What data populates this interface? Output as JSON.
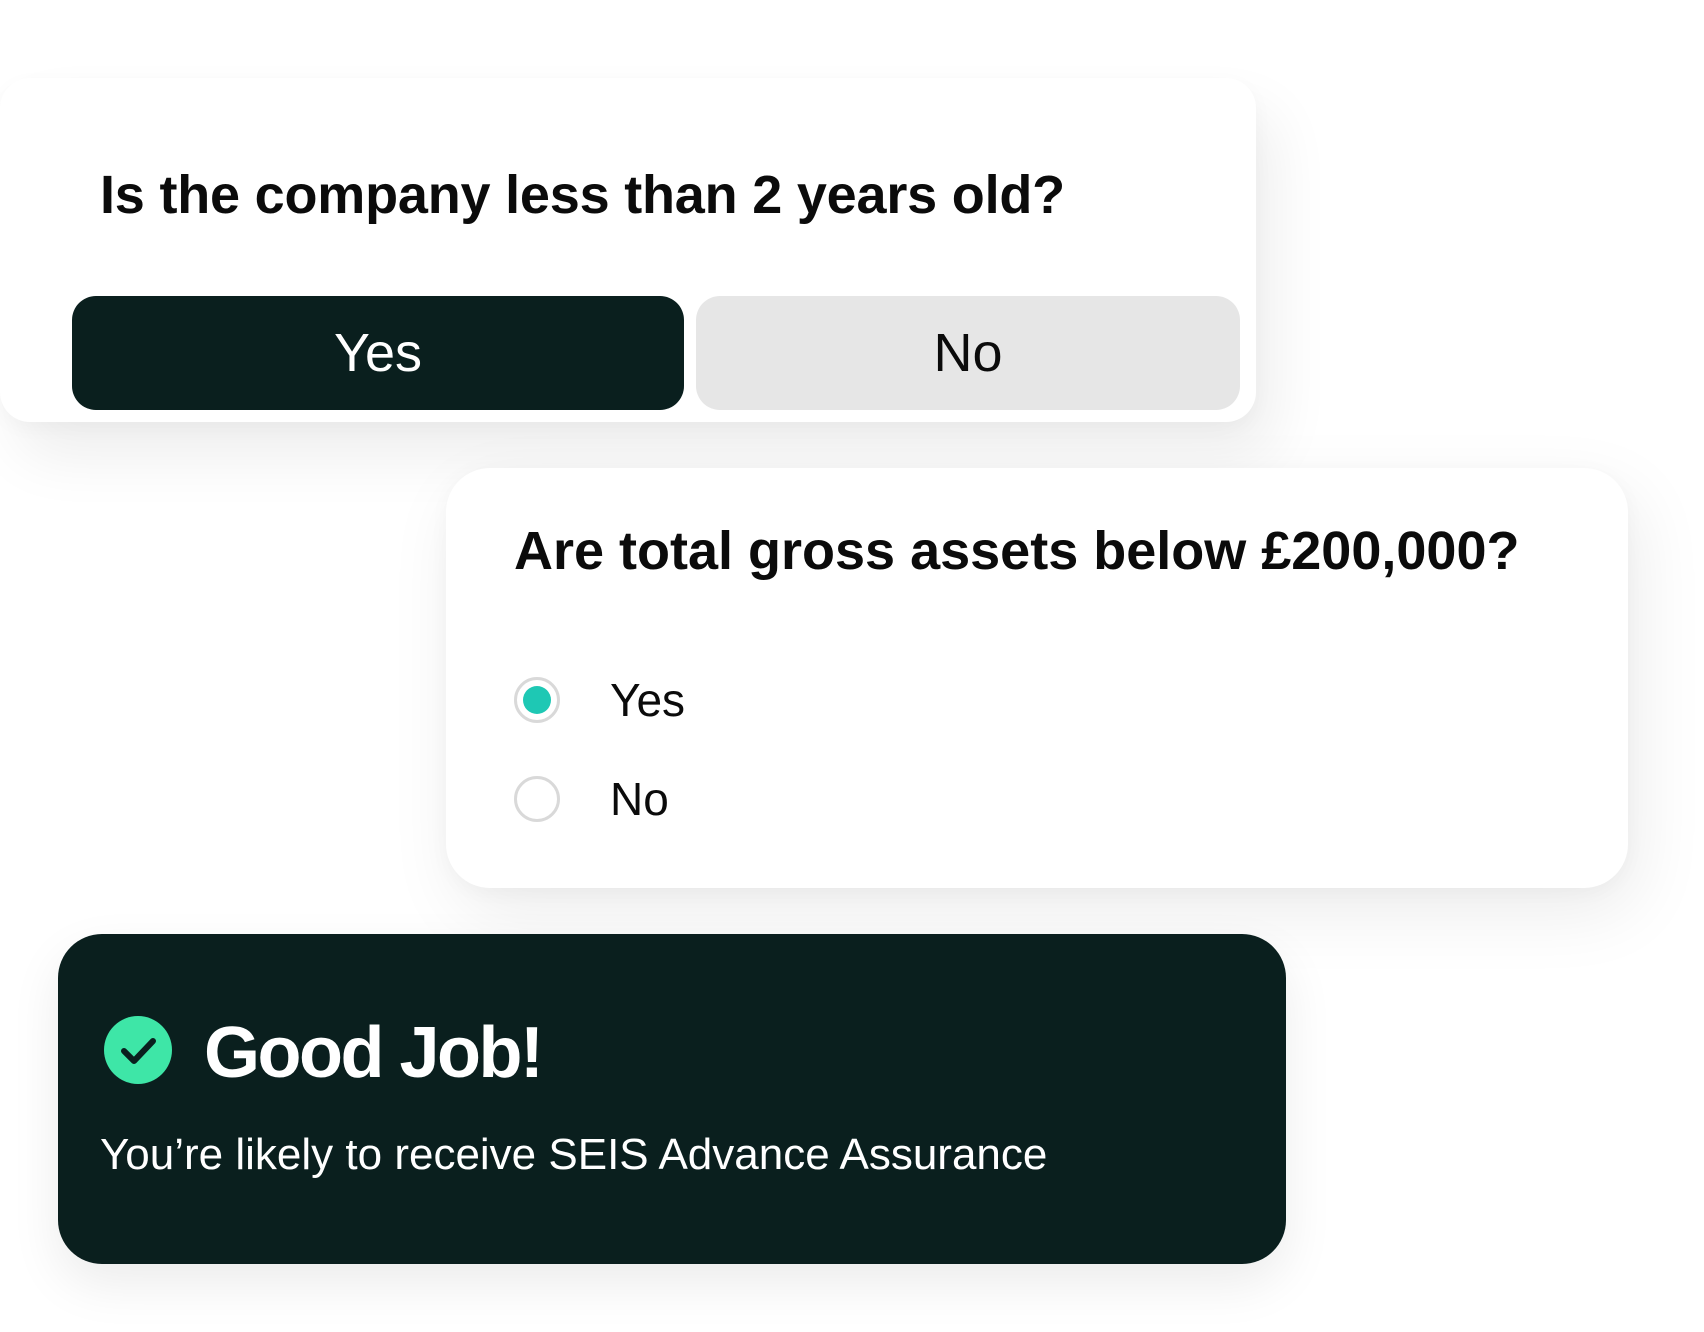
{
  "question1": {
    "text": "Is the company less than 2 years old?",
    "options": [
      "Yes",
      "No"
    ],
    "selected": "Yes"
  },
  "question2": {
    "text": "Are total gross assets below £200,000?",
    "options": [
      "Yes",
      "No"
    ],
    "selected": "Yes"
  },
  "result": {
    "title": "Good Job!",
    "message": "You’re likely to receive SEIS Advance Assurance",
    "icon": "check-circle-icon"
  },
  "colors": {
    "dark": "#0a1f1e",
    "radio_accent": "#1ec8b4",
    "check_green": "#3ee6a7",
    "button_inactive": "#e6e6e6"
  }
}
